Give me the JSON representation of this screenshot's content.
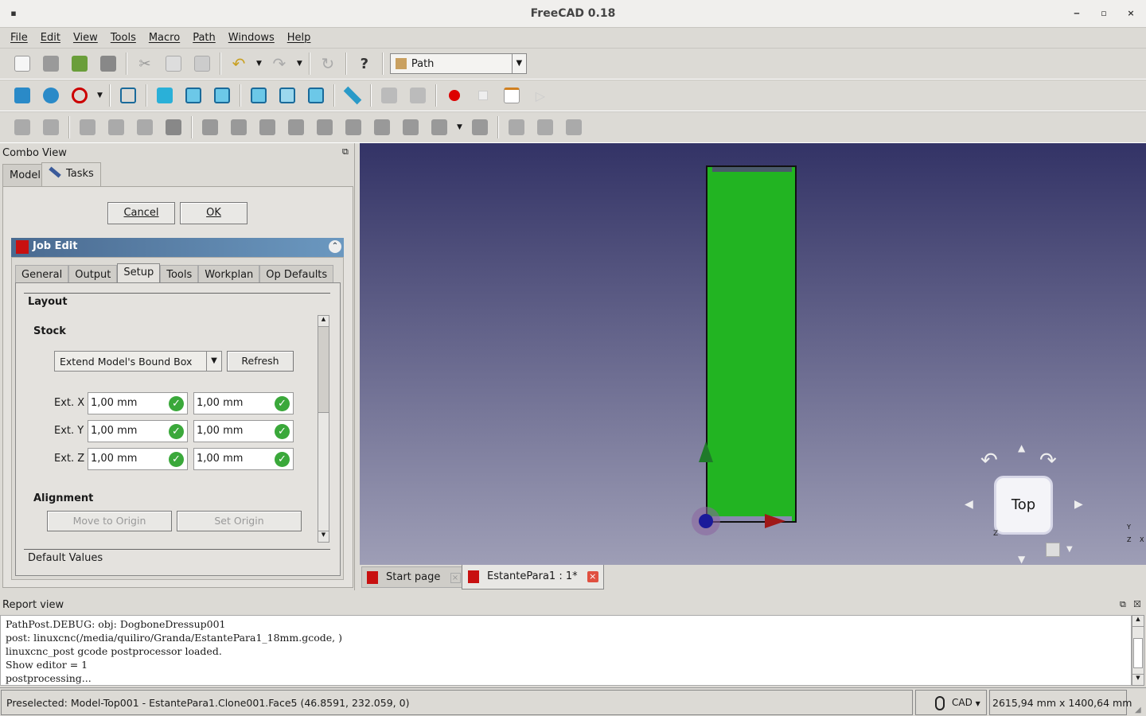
{
  "window": {
    "title": "FreeCAD 0.18",
    "minimize": "‒",
    "maximize": "▫",
    "close": "×"
  },
  "menu": [
    "File",
    "Edit",
    "View",
    "Tools",
    "Macro",
    "Path",
    "Windows",
    "Help"
  ],
  "workbench": {
    "selected": "Path"
  },
  "combo": {
    "title": "Combo View",
    "tabs": [
      "Model",
      "Tasks"
    ],
    "active_tab": "Tasks",
    "cancel": "Cancel",
    "ok": "OK"
  },
  "job_edit": {
    "title": "Job Edit",
    "tabs": [
      "General",
      "Output",
      "Setup",
      "Tools",
      "Workplan",
      "Op Defaults"
    ],
    "active_tab": "Setup",
    "layout": "Layout",
    "stock": "Stock",
    "stock_type": "Extend Model's Bound Box",
    "refresh": "Refresh",
    "ext_rows": [
      {
        "label": "Ext. X",
        "neg": "1,00 mm",
        "pos": "1,00 mm"
      },
      {
        "label": "Ext. Y",
        "neg": "1,00 mm",
        "pos": "1,00 mm"
      },
      {
        "label": "Ext. Z",
        "neg": "1,00 mm",
        "pos": "1,00 mm"
      }
    ],
    "alignment": "Alignment",
    "move_to_origin": "Move to Origin",
    "set_origin": "Set Origin",
    "default_values": "Default Values"
  },
  "view": {
    "navcube_face": "Top",
    "axis_labels": {
      "x": "X",
      "y": "Y",
      "z": "Z"
    },
    "shape_color": "#22b422",
    "background_top": "#333366",
    "background_bottom": "#9e9eb6"
  },
  "doc_tabs": [
    {
      "label": "Start page"
    },
    {
      "label": "EstantePara1 : 1*"
    }
  ],
  "report": {
    "title": "Report view",
    "lines": [
      "PathPost.DEBUG: obj: DogboneDressup001",
      "post: linuxcnc(/media/quiliro/Granda/EstantePara1_18mm.gcode, )",
      "linuxcnc_post gcode postprocessor loaded.",
      "Show editor = 1",
      "postprocessing..."
    ]
  },
  "status": {
    "message": "Preselected: Model-Top001 - EstantePara1.Clone001.Face5 (46.8591, 232.059, 0)",
    "nav_style": "CAD",
    "dimensions": "2615,94 mm x 1400,64 mm"
  }
}
